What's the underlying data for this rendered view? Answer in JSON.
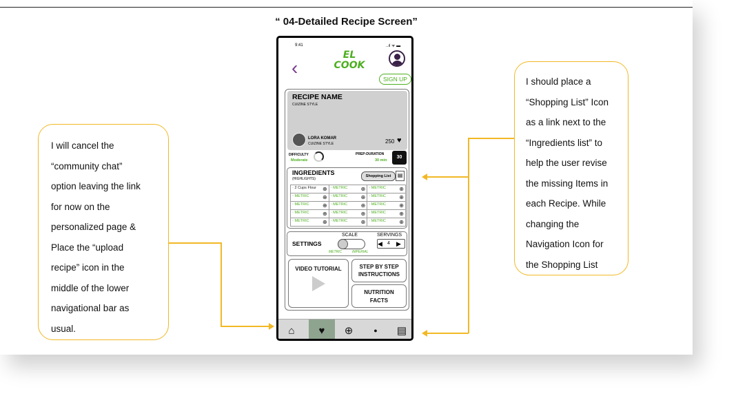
{
  "slide": {
    "title": "“ 04-Detailed Recipe Screen”"
  },
  "notes": {
    "left": "I will cancel the\n“community chat”\noption leaving the link\nfor now on the\npersonalized page &\nPlace the “upload\nrecipe” icon in the\nmiddle of the lower\nnavigational bar as\nusual.",
    "right": "I should place a\n“Shopping List” Icon\nas a link next to the\n“Ingredients list” to\nhelp the user revise\nthe missing Items in\neach Recipe. While\nchanging the\nNavigation Icon for\nthe Shopping List"
  },
  "phone": {
    "status": {
      "time": "9:41",
      "icons": "..ıl ᯤ ▬"
    },
    "logo": {
      "line1": "EL",
      "line2": "COOK"
    },
    "back_icon": "‹",
    "signup_label": "SIGN UP",
    "recipe": {
      "name": "RECIPE NAME",
      "style": "CUIZINE STYLE",
      "author": "LORA KOMAR",
      "author_style": "CUIZINE STYLE",
      "likes": "250"
    },
    "difficulty": {
      "label": "DIFFICULTY",
      "value": "Moderate"
    },
    "prep": {
      "label": "PREP-DURATION",
      "value": "30 min",
      "badge": "30"
    },
    "ingredients": {
      "title": "INGREDIENTS",
      "subtitle": "(HIGHLIGHTS)",
      "shopping_label": "Shopping List",
      "rows": [
        [
          "2 Cups Flour",
          "METRIC",
          "METRIC"
        ],
        [
          "METRIC",
          "METRIC",
          "METRIC"
        ],
        [
          "METRIC",
          "METRIC",
          "METRIC"
        ],
        [
          "METRIC",
          "METRIC",
          "METRIC"
        ],
        [
          "METRIC",
          "METRIC",
          "METRIC"
        ]
      ]
    },
    "settings": {
      "label": "SETTINGS",
      "scale_label": "SCALE",
      "metric": "METRIC",
      "imperial": "IMPERIAL",
      "servings_label": "SERVINGS",
      "servings_value": "4"
    },
    "video_label": "VIDEO TUTORIAL",
    "steps_label": "STEP BY STEP INSTRUCTIONS",
    "nutrition_label": "NUTRITION FACTS",
    "nav": {
      "items": [
        {
          "icon": "home-icon",
          "glyph": "⌂"
        },
        {
          "icon": "heart-icon",
          "glyph": "♥"
        },
        {
          "icon": "plus-circle-icon",
          "glyph": "⊕"
        },
        {
          "icon": "search-icon",
          "glyph": "●"
        },
        {
          "icon": "shopping-list-icon",
          "glyph": "▤"
        }
      ]
    }
  },
  "colors": {
    "accent_green": "#4caf1f",
    "note_border": "#f2b824",
    "back_purple": "#7b3a8c",
    "nav_active": "#8fa48f"
  }
}
